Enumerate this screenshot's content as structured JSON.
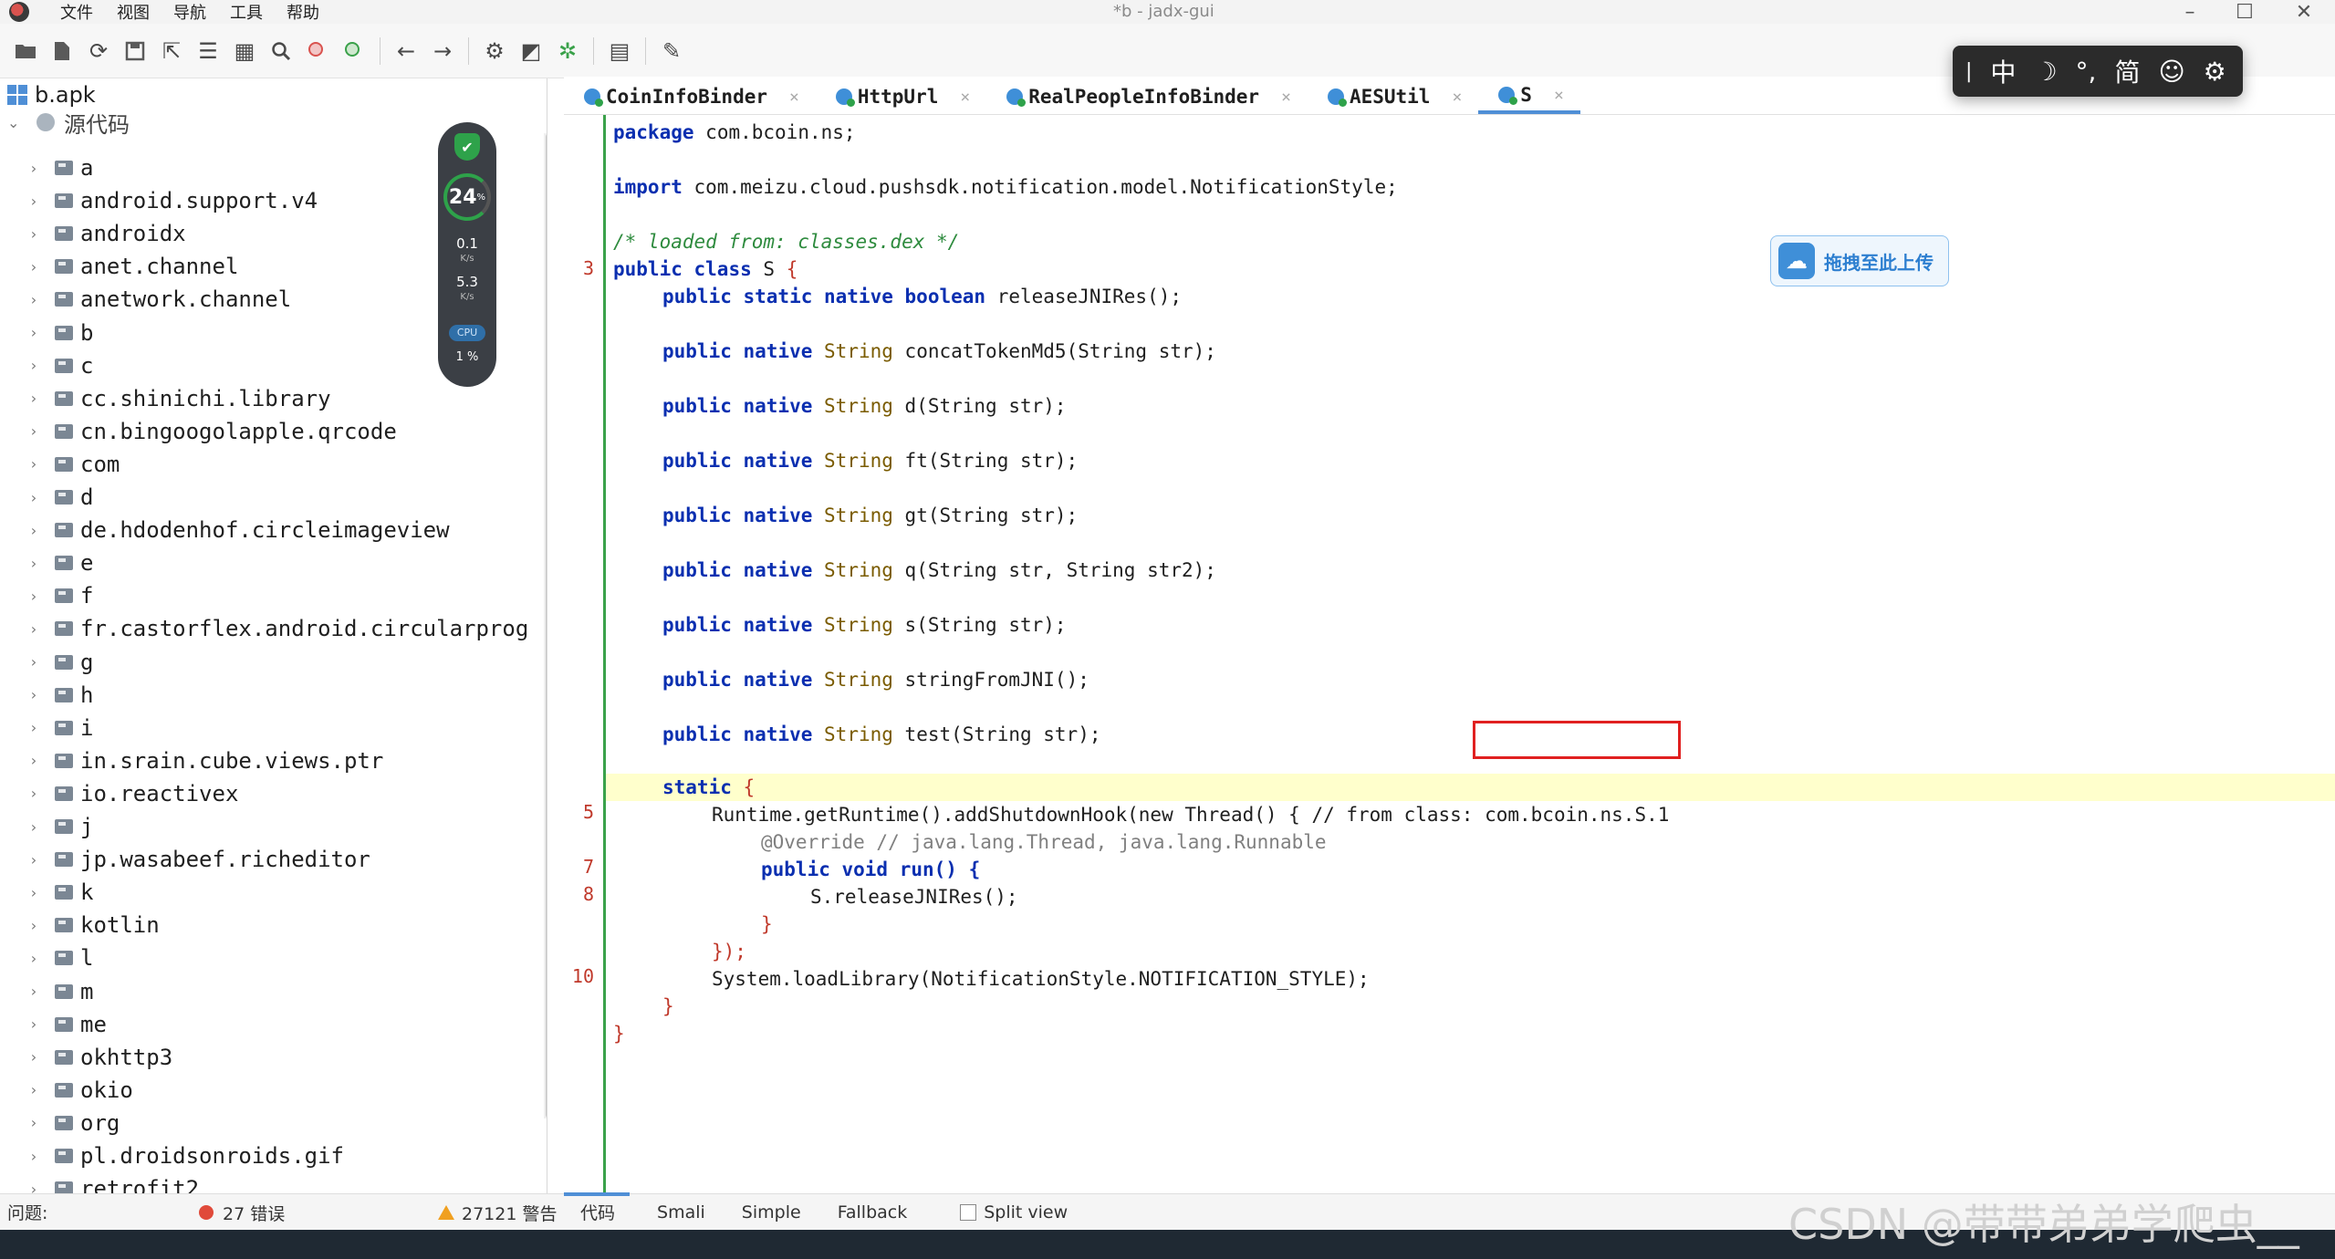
{
  "menu": [
    "文件",
    "视图",
    "导航",
    "工具",
    "帮助"
  ],
  "window": {
    "title": "*b - jadx-gui"
  },
  "tree": {
    "root": "b.apk",
    "source_folder": "源代码",
    "packages": [
      "a",
      "android.support.v4",
      "androidx",
      "anet.channel",
      "anetwork.channel",
      "b",
      "c",
      "cc.shinichi.library",
      "cn.bingoogolapple.qrcode",
      "com",
      "d",
      "de.hdodenhof.circleimageview",
      "e",
      "f",
      "fr.castorflex.android.circularprog",
      "g",
      "h",
      "i",
      "in.srain.cube.views.ptr",
      "io.reactivex",
      "j",
      "jp.wasabeef.richeditor",
      "k",
      "kotlin",
      "l",
      "m",
      "me",
      "okhttp3",
      "okio",
      "org",
      "pl.droidsonroids.gif",
      "retrofit2"
    ]
  },
  "perf_widget": {
    "percent": "24",
    "percent_unit": "%",
    "up": "0.1",
    "down": "5.3",
    "unit": "K/s",
    "cpu_label": "CPU",
    "cpu_value": "1 %"
  },
  "tabs": [
    {
      "label": "CoinInfoBinder"
    },
    {
      "label": "HttpUrl"
    },
    {
      "label": "RealPeopleInfoBinder"
    },
    {
      "label": "AESUtil"
    },
    {
      "label": "S",
      "active": true
    }
  ],
  "code": {
    "package_kw": "package",
    "package_name": "com.bcoin.ns;",
    "import_kw": "import",
    "import_name": "com.meizu.cloud.pushsdk.notification.model.NotificationStyle;",
    "loaded_comment": "/* loaded from: classes.dex */",
    "class_decl": {
      "kw1": "public",
      "kw2": "class",
      "name": "S",
      "brace": "{"
    },
    "methods": [
      {
        "mods": "public static native",
        "ret": "boolean",
        "sig": "releaseJNIRes",
        "args": "();"
      },
      {
        "mods": "public native",
        "ret": "String",
        "sig": "concatTokenMd5",
        "args": "(String str);"
      },
      {
        "mods": "public native",
        "ret": "String",
        "sig": "d",
        "args": "(String str);"
      },
      {
        "mods": "public native",
        "ret": "String",
        "sig": "ft",
        "args": "(String str);"
      },
      {
        "mods": "public native",
        "ret": "String",
        "sig": "gt",
        "args": "(String str);"
      },
      {
        "mods": "public native",
        "ret": "String",
        "sig": "q",
        "args": "(String str, String str2);"
      },
      {
        "mods": "public native",
        "ret": "String",
        "sig": "s",
        "args": "(String str);"
      },
      {
        "mods": "public native",
        "ret": "String",
        "sig": "stringFromJNI",
        "args": "();"
      },
      {
        "mods": "public native",
        "ret": "String",
        "sig": "test",
        "args": "(String str);"
      }
    ],
    "static_kw": "static",
    "line_runtime": "Runtime.getRuntime().addShutdownHook(new Thread() { // from class: com.bcoin.ns.S.1",
    "line_override": "@Override // java.lang.Thread, java.lang.Runnable",
    "line_run": "public void run() {",
    "line_release": "S.releaseJNIRes();",
    "line_close1": "}",
    "line_close2": "});",
    "line_load": "System.loadLibrary(NotificationStyle.NOTIFICATION_STYLE);",
    "line_close3": "}",
    "line_close4": "}",
    "line_numbers": [
      "3",
      "5",
      "7",
      "8",
      "10"
    ]
  },
  "upload_button": {
    "label": "拖拽至此上传"
  },
  "ime_toolbar": {
    "items": [
      "中",
      "☽",
      "°,",
      "简",
      "☺",
      "⚙"
    ]
  },
  "bottom_tabs": [
    "代码",
    "Smali",
    "Simple",
    "Fallback"
  ],
  "split_view": "Split view",
  "status": {
    "label": "问题:",
    "errors": "27 错误",
    "warnings": "27121 警告"
  },
  "watermark": "CSDN @带带弟弟学爬虫__"
}
